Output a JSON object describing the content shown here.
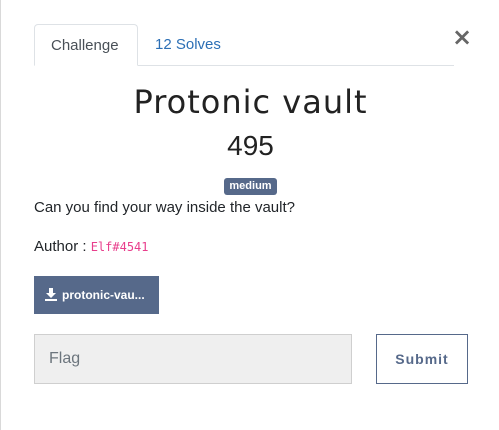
{
  "modal": {
    "close_label": "×"
  },
  "tabs": [
    {
      "label": "Challenge",
      "active": true
    },
    {
      "label": "12 Solves",
      "active": false
    }
  ],
  "challenge": {
    "name": "Protonic vault",
    "value": "495",
    "difficulty": "medium",
    "description": "Can you find your way inside the vault?",
    "author_label": "Author : ",
    "author_name": "Elf#4541",
    "download_label": "protonic-vau..."
  },
  "submission": {
    "flag_placeholder": "Flag",
    "flag_value": "",
    "submit_label": "Submit"
  },
  "colors": {
    "accent": "#56698a",
    "link": "#2c6fb5",
    "author_code": "#e83e8c"
  },
  "icons": {
    "download": "download-icon",
    "close": "close-icon"
  }
}
